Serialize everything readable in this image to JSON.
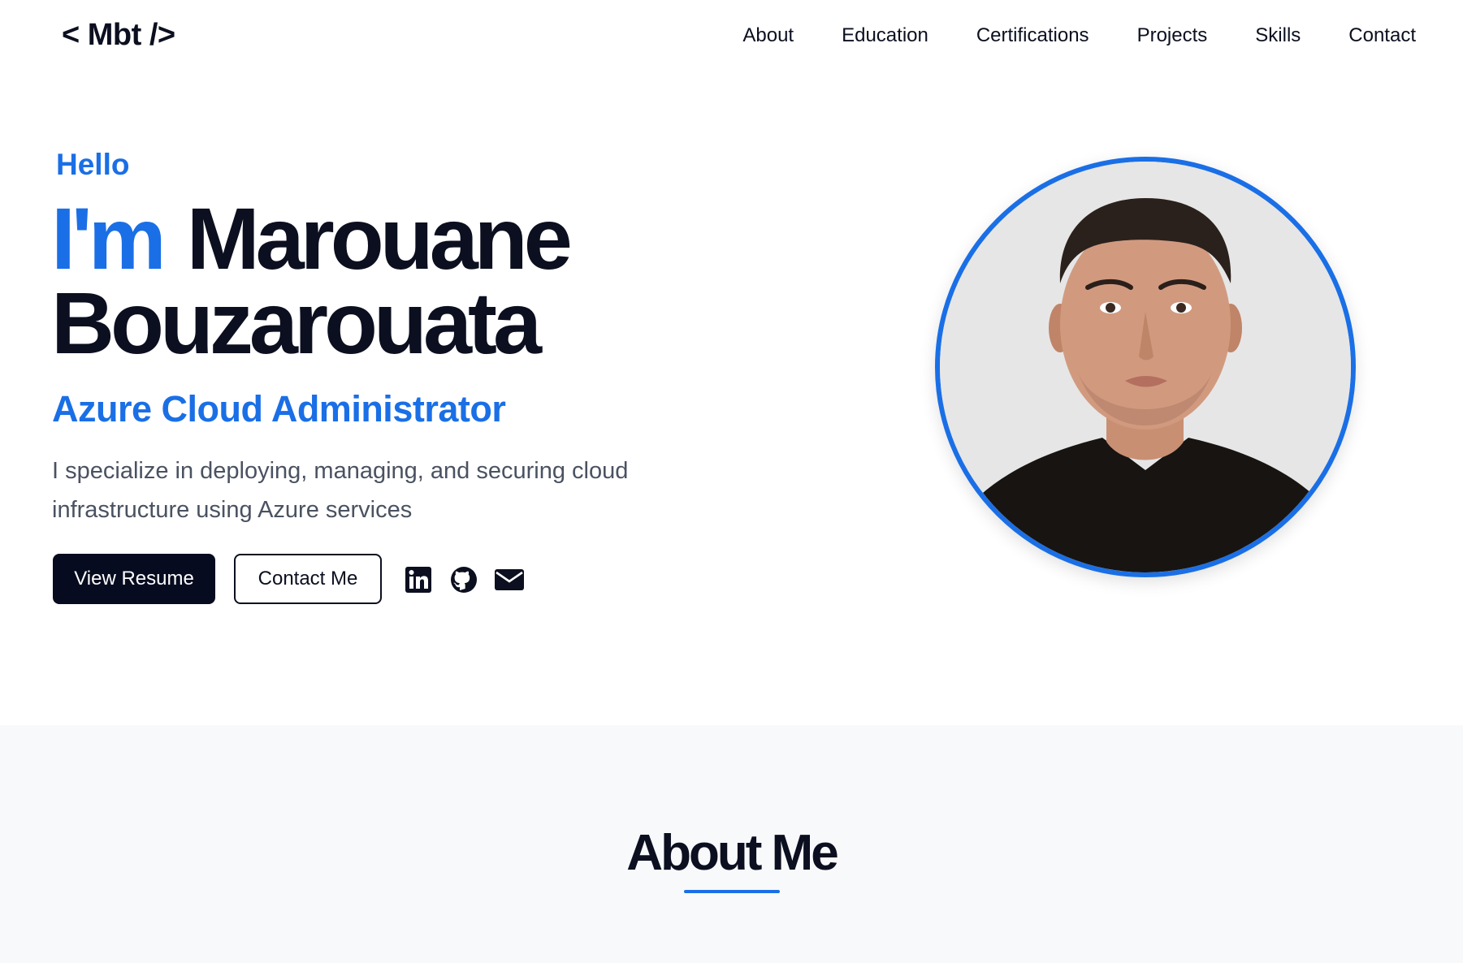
{
  "header": {
    "logo": "< Mbt />",
    "nav": [
      "About",
      "Education",
      "Certifications",
      "Projects",
      "Skills",
      "Contact"
    ]
  },
  "hero": {
    "greeting": "Hello",
    "name_prefix": "I'm",
    "first_name": "Marouane",
    "last_name": "Bouzarouata",
    "role": "Azure Cloud Administrator",
    "description": "I specialize in deploying, managing, and securing cloud infrastructure using Azure services",
    "buttons": {
      "resume": "View Resume",
      "contact": "Contact Me"
    },
    "social_icons": [
      "linkedin-icon",
      "github-icon",
      "mail-icon"
    ]
  },
  "about": {
    "title": "About Me"
  },
  "colors": {
    "accent": "#1a6fe6",
    "dark": "#070b1f",
    "muted_text": "#4a5261",
    "section_bg": "#f8f9fb"
  }
}
